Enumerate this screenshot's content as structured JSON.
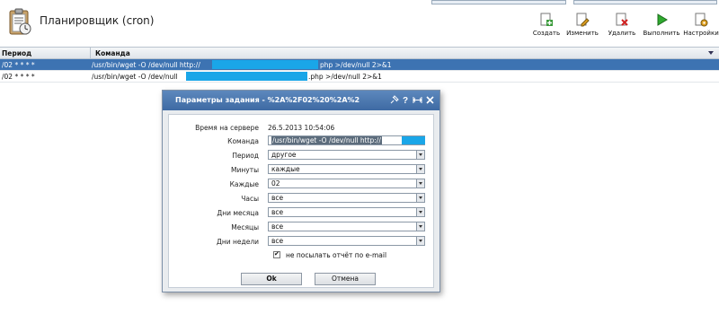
{
  "app": {
    "title": "Планировщик (cron)",
    "icon": "clipboard-icon"
  },
  "toolbar": {
    "create": {
      "label": "Создать",
      "icon": "create-icon"
    },
    "edit": {
      "label": "Изменить",
      "icon": "edit-icon"
    },
    "delete": {
      "label": "Удалить",
      "icon": "delete-icon"
    },
    "run": {
      "label": "Выполнить",
      "icon": "run-icon"
    },
    "settings": {
      "label": "Настройки",
      "icon": "settings-icon"
    }
  },
  "table": {
    "columns": [
      "Период",
      "Команда"
    ],
    "rows": [
      {
        "period": "/02 * * * *",
        "command_start": "/usr/bin/wget -O /dev/null http://",
        "command_end": "php >/dev/null 2>&1",
        "selected": true
      },
      {
        "period": "/02 * * * *",
        "command_start": "/usr/bin/wget -O /dev/null",
        "command_end": ".php >/dev/null 2>&1",
        "selected": false
      }
    ]
  },
  "dialog": {
    "title": "Параметры задания - %2A%2F02%20%2A%2",
    "fields": {
      "server_time_label": "Время на сервере",
      "server_time_value": "26.5.2013 10:54:06",
      "command_label": "Команда",
      "command_value": "/usr/bin/wget -O /dev/null http://",
      "period_label": "Период",
      "period_value": "другое",
      "minutes_label": "Минуты",
      "minutes_value": "каждые",
      "every_label": "Каждые",
      "every_value": "02",
      "hours_label": "Часы",
      "hours_value": "все",
      "days_label": "Дни месяца",
      "days_value": "все",
      "months_label": "Месяцы",
      "months_value": "все",
      "weekdays_label": "Дни недели",
      "weekdays_value": "все"
    },
    "checkbox_label": "не посылать отчёт по e-mail",
    "checkbox_checked": true,
    "ok_label": "Ok",
    "cancel_label": "Отмена"
  },
  "colors": {
    "selection": "#3d73b2",
    "titlebar": "#4a78b0",
    "redaction": "#1aa6e8"
  }
}
